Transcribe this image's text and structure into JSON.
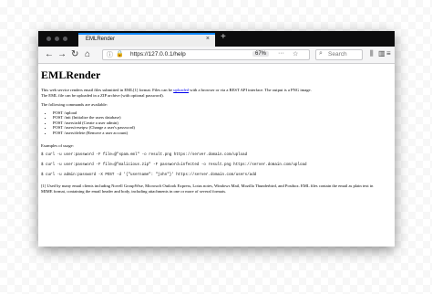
{
  "browser": {
    "tab_title": "EMLRender",
    "tab_close": "×",
    "new_tab": "+",
    "nav": {
      "back": "←",
      "forward": "→",
      "reload": "↻",
      "home": "⌂"
    },
    "url": "https://127.0.0.1/help",
    "zoom": "67%",
    "page_actions": "···",
    "search_placeholder": "Search",
    "icons": [
      "library-icon",
      "sidebar-icon",
      "menu-icon"
    ]
  },
  "page": {
    "title": "EMLRender",
    "intro_1": "This web service renders email files submitted in EML[1] format. Files can be ",
    "intro_link": "uploaded",
    "intro_2": " with a browser or via a REST API interface. The output is a PNG image.",
    "intro_3": "The EML file can be uploaded in a ZIP archive (with optional password).",
    "commands_heading": "The following commands are available:",
    "commands": [
      "POST /upload",
      "POST /init (Initialize the users database)",
      "POST /users/add (Create a user admin)",
      "POST /users/resetpw (Change a user's password)",
      "POST /users/delete (Remove a user account)"
    ],
    "examples_heading": "Examples of usage:",
    "examples": [
      "$ curl -u user:password -F file=@\"spam.eml\" -o result.png https://server.domain.com/upload",
      "$ curl -u user:password -F file=@\"malicious.zip\" -F password=infected -o result.png https://server.domain.com/upload",
      "$ curl -u admin:password -X POST -d '{\"username\": \"john\"}' https://server.domain.com/users/add"
    ],
    "footnote_1": "[1] Used by many email clients including Novell GroupWise, Microsoft Outlook Express, Lotus notes, Windows Mail, Mozilla Thunderbird, and Postbox. EML files contain the email as plain text in",
    "footnote_2": "MIME format, containing the email header and body, including attachments in one or more of several formats."
  }
}
